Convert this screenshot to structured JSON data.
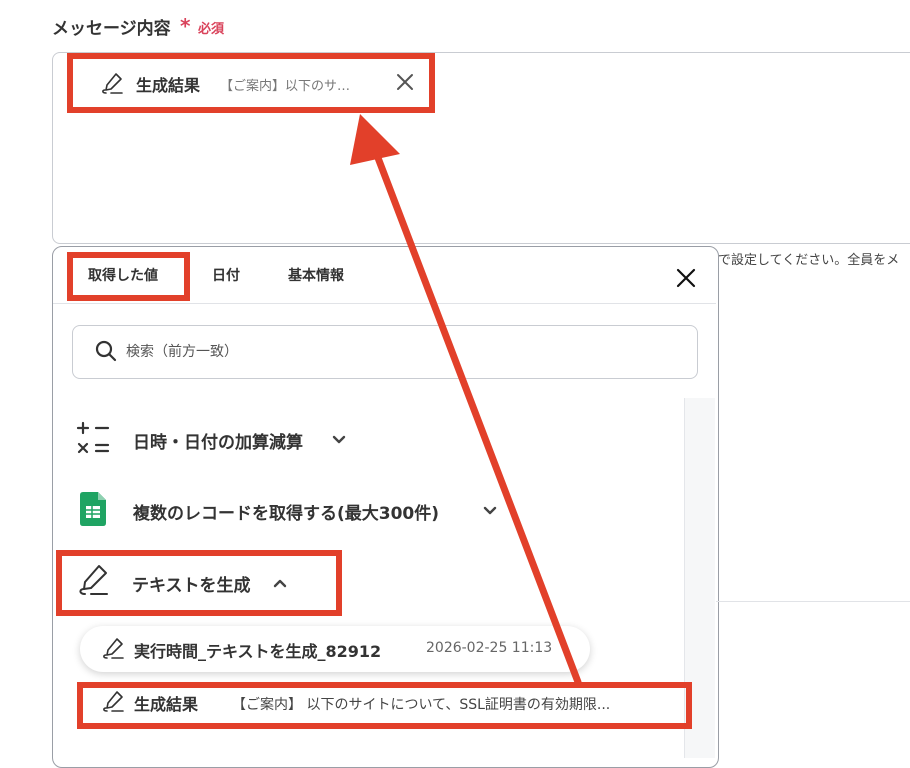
{
  "field": {
    "label": "メッセージ内容",
    "required_star": "*",
    "required_text": "必須",
    "hint": "で設定してください。全員をメ"
  },
  "chip": {
    "title": "生成結果",
    "preview": "【ご案内】以下のサ…",
    "icon": "pen-icon"
  },
  "panel": {
    "tabs": [
      {
        "label": "取得した値",
        "active": true
      },
      {
        "label": "日付",
        "active": false
      },
      {
        "label": "基本情報",
        "active": false
      }
    ],
    "search_placeholder": "検索（前方一致）",
    "items": [
      {
        "label": "日時・日付の加算減算",
        "icon": "calculator-icon",
        "state": "collapsed"
      },
      {
        "label": "複数のレコードを取得する(最大300件)",
        "icon": "google-sheets-icon",
        "state": "collapsed"
      },
      {
        "label": "テキストを生成",
        "icon": "pen-icon",
        "state": "expanded"
      }
    ],
    "sub_items": [
      {
        "title": "実行時間_テキストを生成_82912",
        "value": "2026-02-25 11:13"
      },
      {
        "title": "生成結果",
        "value": "【ご案内】 以下のサイトについて、SSL証明書の有効期限..."
      }
    ]
  },
  "colors": {
    "highlight": "#e2402a",
    "required": "#d9435b",
    "sheets_green": "#1fa463",
    "text": "#333333"
  }
}
